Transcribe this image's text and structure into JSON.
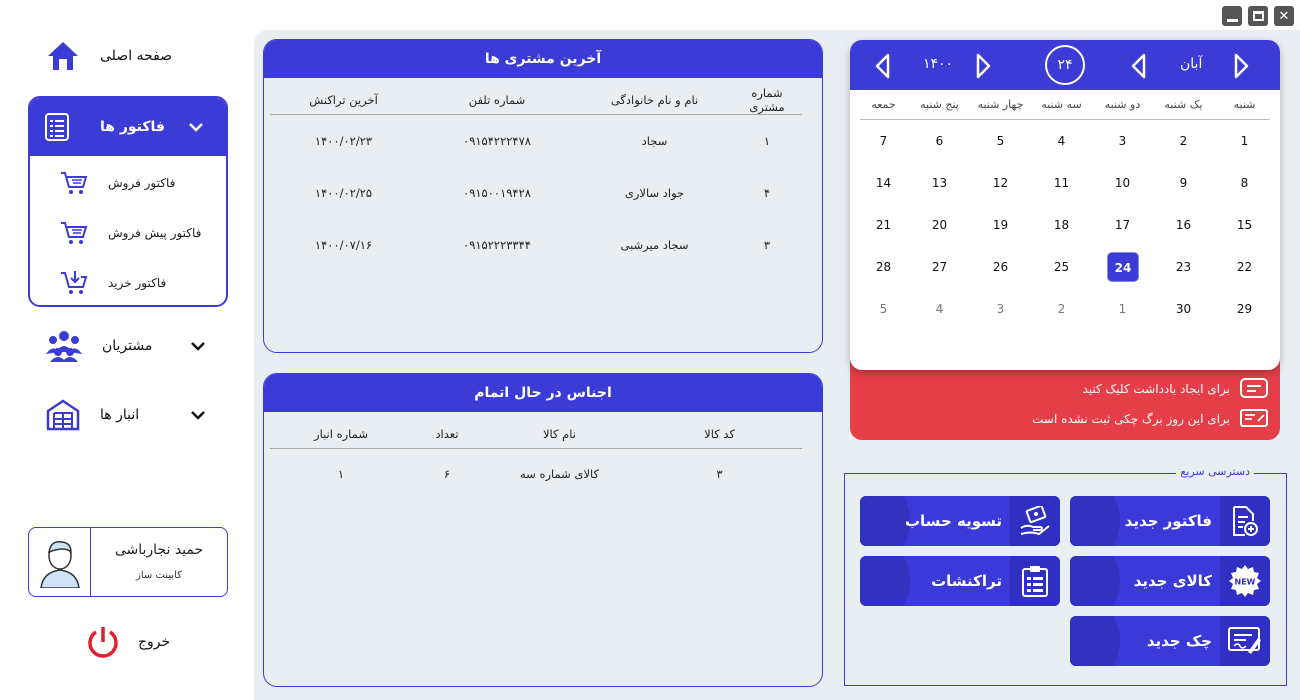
{
  "sidebar": {
    "home": "صفحه اصلی",
    "invoices": {
      "title": "فاکتور ها",
      "items": [
        "فاکتور فروش",
        "فاکتور پیش فروش",
        "فاکتور خرید"
      ]
    },
    "customers": "مشتریان",
    "warehouses": "انبار ها",
    "user": {
      "name": "حمید نجارباشی",
      "role": "کابینت ساز"
    },
    "logout": "خروج"
  },
  "recent_customers": {
    "title": "آخرین مشتری ها",
    "columns": [
      "شماره مشتری",
      "نام و نام خانوادگی",
      "شماره تلفن",
      "آخرین تراکنش"
    ],
    "rows": [
      [
        "۱",
        "سجاد",
        "۰۹۱۵۴۲۲۲۴۷۸",
        "۱۴۰۰/۰۲/۲۳"
      ],
      [
        "۴",
        "جواد سالاری",
        "۰۹۱۵۰۰۱۹۴۲۸",
        "۱۴۰۰/۰۲/۲۵"
      ],
      [
        "۳",
        "سجاد میرشبی",
        "۰۹۱۵۲۲۲۳۳۴۴",
        "۱۴۰۰/۰۷/۱۶"
      ]
    ]
  },
  "low_stock": {
    "title": "اجناس در حال اتمام",
    "columns": [
      "کد کالا",
      "نام کالا",
      "تعداد",
      "شماره انبار"
    ],
    "rows": [
      [
        "۳",
        "کالای شماره سه",
        "۶",
        "۱"
      ]
    ]
  },
  "calendar": {
    "month": "آبان",
    "day": "۲۴",
    "year": "۱۴۰۰",
    "day_names": [
      "شنبه",
      "یک شنبه",
      "دو شنبه",
      "سه شنبه",
      "چهار شنبه",
      "پنج شنبه",
      "جمعه"
    ],
    "weeks": [
      [
        "1",
        "2",
        "3",
        "4",
        "5",
        "6",
        "7"
      ],
      [
        "8",
        "9",
        "10",
        "11",
        "12",
        "13",
        "14"
      ],
      [
        "15",
        "16",
        "17",
        "18",
        "19",
        "20",
        "21"
      ],
      [
        "22",
        "23",
        "24",
        "25",
        "26",
        "27",
        "28"
      ],
      [
        "29",
        "30",
        "1",
        "2",
        "3",
        "4",
        "5"
      ]
    ],
    "selected": "24"
  },
  "notes": {
    "create_note": "برای ایجاد یادداشت کلیک کنید",
    "no_check": "برای این روز برگ چکی ثبت نشده است"
  },
  "quick_access": {
    "label": "دسترسی سریع",
    "buttons": {
      "new_invoice": "فاکتور جدید",
      "settle": "تسویه حساب",
      "new_product": "کالای جدید",
      "transactions": "تراکنشات",
      "new_check": "چک جدید"
    },
    "new_badge": "NEW"
  },
  "colors": {
    "accent": "#3b3bd6",
    "danger": "#e63e48",
    "logout": "#e0202a"
  }
}
